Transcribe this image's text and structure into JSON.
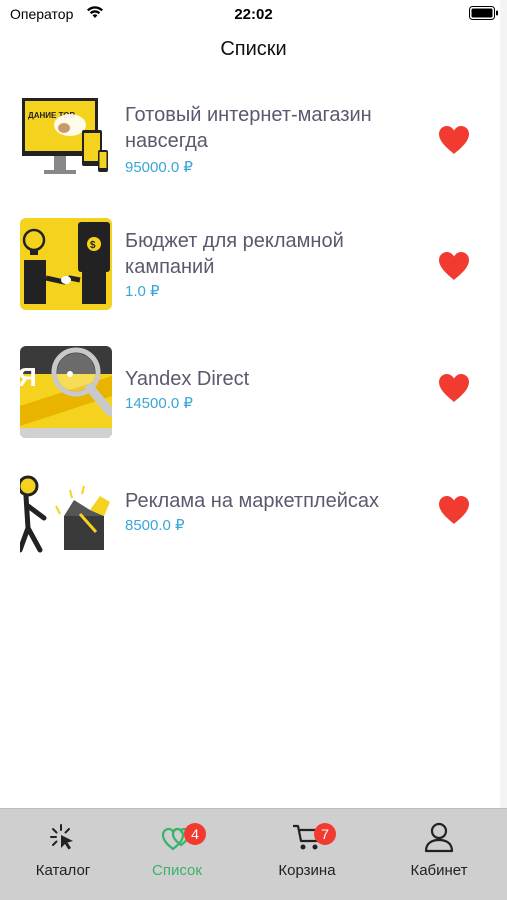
{
  "status_bar": {
    "carrier": "Оператор",
    "time": "22:02"
  },
  "header": {
    "title": "Списки"
  },
  "items": [
    {
      "title": " Готовый интернет-магазин навсегда",
      "price": "95000.0 ₽"
    },
    {
      "title": "Бюджет для рекламной кампаний",
      "price": "1.0 ₽"
    },
    {
      "title": "Yandex Direct",
      "price": "14500.0 ₽"
    },
    {
      "title": "Реклама на маркетплейсах",
      "price": "8500.0 ₽"
    }
  ],
  "thumb1_text": "ДАНИЕ ТОВ",
  "thumb3_text": "Я",
  "tabs": [
    {
      "label": "Каталог",
      "icon": "cursor-click-icon"
    },
    {
      "label": "Список",
      "icon": "hearts-icon",
      "badge": "4",
      "active": true
    },
    {
      "label": "Корзина",
      "icon": "cart-icon",
      "badge": "7"
    },
    {
      "label": "Кабинет",
      "icon": "user-icon"
    }
  ],
  "colors": {
    "heart": "#f23b30",
    "price": "#38a6d8",
    "active_tab": "#39b36a",
    "tab_bar_bg": "#cfcfcf",
    "badge": "#f23b30"
  }
}
